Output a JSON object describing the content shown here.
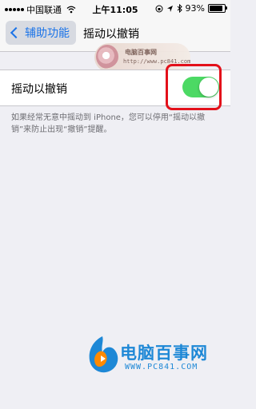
{
  "status_bar": {
    "carrier": "中国联通",
    "time": "上午11:05",
    "battery": "93%"
  },
  "nav": {
    "back_label": "辅助功能",
    "title": "摇动以撤销"
  },
  "watermark": {
    "title": "电脑百事网",
    "url": "http://www.pc841.com"
  },
  "setting": {
    "label": "摇动以撤销",
    "toggle_on": true
  },
  "footer_note": "如果经常无意中摇动到 iPhone，您可以停用“摇动以撤销”来防止出现“撤销”提醒。",
  "brand": {
    "name": "电脑百事网",
    "url": "WWW.PC841.COM"
  },
  "colors": {
    "accent": "#1a73e8",
    "toggle_on": "#4cd964",
    "highlight": "#e3101a",
    "brand": "#1e88d6"
  }
}
